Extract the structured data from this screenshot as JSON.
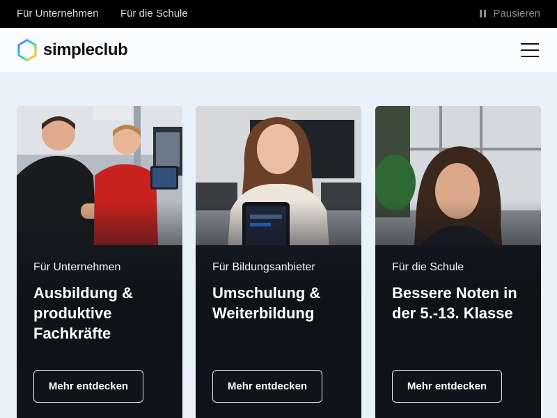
{
  "topbar": {
    "links": [
      "Für Unternehmen",
      "Für die Schule"
    ],
    "pause_label": "Pausieren"
  },
  "header": {
    "logo_text": "simpleclub",
    "menu_icon": "hamburger-menu-icon"
  },
  "cards": [
    {
      "eyebrow": "Für Unternehmen",
      "headline": "Ausbildung & produktive Fachkräfte",
      "cta": "Mehr entdecken"
    },
    {
      "eyebrow": "Für Bildungsanbieter",
      "headline": "Umschulung & Weiterbildung",
      "cta": "Mehr entdecken"
    },
    {
      "eyebrow": "Für die Schule",
      "headline": "Bessere Noten in der 5.-13. Klasse",
      "cta": "Mehr entdecken"
    }
  ],
  "colors": {
    "topbar_bg": "#000000",
    "page_bg": "#e9f2fb",
    "card_text": "#ffffff"
  }
}
